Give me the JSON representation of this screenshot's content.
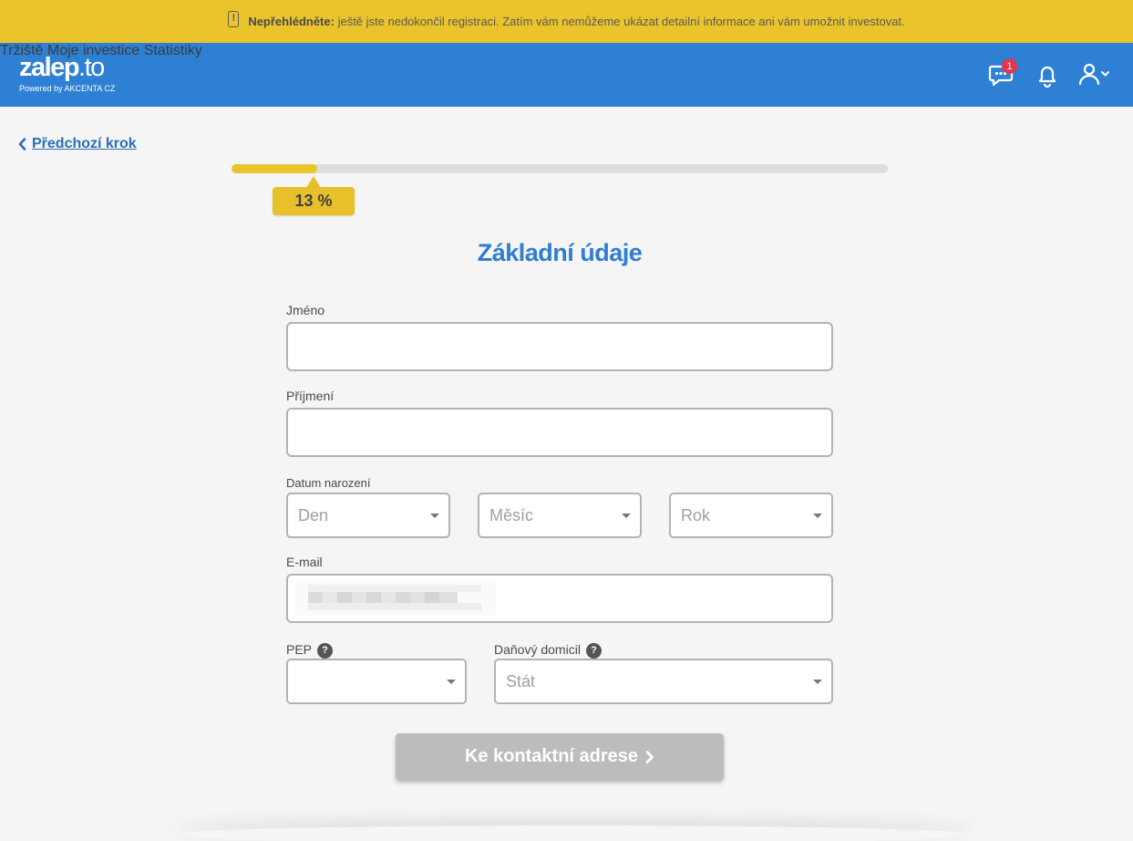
{
  "banner": {
    "icon": "alert-icon",
    "lead": "Nepřehlédněte:",
    "message": "ještě jste nedokončil registraci. Zatím vám nemůžeme ukázat detailní informace ani vám umožnit investovat."
  },
  "header": {
    "logo_main": "zalep",
    "logo_suffix": "to",
    "logo_dot": ".",
    "powered_by": "Powered by AKCENTA CZ",
    "nav": [
      "Tržiště",
      "Moje investice",
      "Statistiky"
    ],
    "messages_badge": "1",
    "icons": [
      "chat-icon",
      "bell-icon",
      "user-icon"
    ]
  },
  "colors": {
    "banner": "#ebc42b",
    "header": "#2e80d4",
    "title": "#2e7ed1",
    "badge": "#e3374b",
    "progress": "#ebc42b",
    "button_disabled": "#bcbcbc"
  },
  "back_link": "Předchozí krok",
  "progress": {
    "label": "13 %",
    "fraction": 0.13
  },
  "title": "Základní údaje",
  "form": {
    "first_name": {
      "label": "Jméno",
      "value": ""
    },
    "last_name": {
      "label": "Příjmení",
      "value": ""
    },
    "birth_date": {
      "label": "Datum narození",
      "day": "Den",
      "month": "Měsíc",
      "year": "Rok"
    },
    "email": {
      "label": "E-mail"
    },
    "pep": {
      "label": "PEP",
      "value": ""
    },
    "tax": {
      "label": "Daňový domicil",
      "placeholder": "Stát"
    }
  },
  "submit_label": "Ke kontaktní adrese"
}
